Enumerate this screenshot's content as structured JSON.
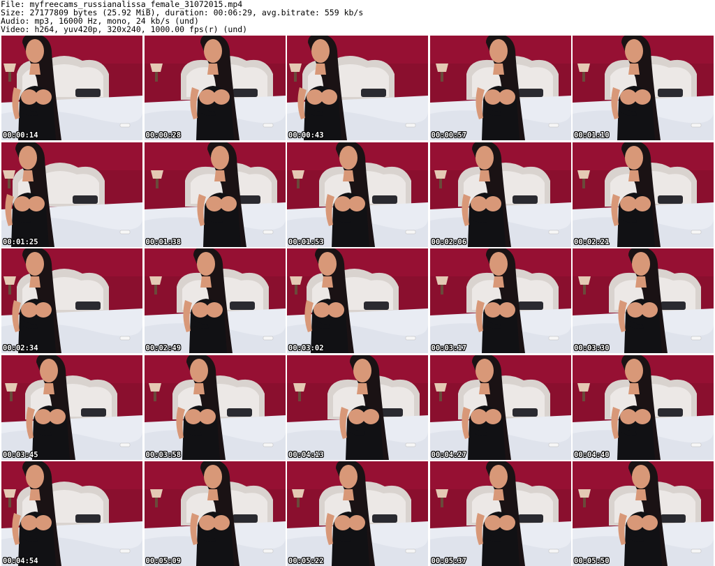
{
  "header": {
    "file_line": "File: myfreecams_russianalissa_female_31072015.mp4",
    "size_line": "Size: 27177809 bytes (25.92 MiB), duration: 00:06:29, avg.bitrate: 559 kb/s",
    "audio_line": "Audio: mp3, 16000 Hz, mono, 24 kb/s (und)",
    "video_line": "Video: h264, yuv420p, 320x240, 1000.00 fps(r) (und)"
  },
  "thumbnails": [
    {
      "timestamp": "00:00:14"
    },
    {
      "timestamp": "00:00:28"
    },
    {
      "timestamp": "00:00:43"
    },
    {
      "timestamp": "00:00:57"
    },
    {
      "timestamp": "00:01:10"
    },
    {
      "timestamp": "00:01:25"
    },
    {
      "timestamp": "00:01:38"
    },
    {
      "timestamp": "00:01:53"
    },
    {
      "timestamp": "00:02:06"
    },
    {
      "timestamp": "00:02:21"
    },
    {
      "timestamp": "00:02:34"
    },
    {
      "timestamp": "00:02:49"
    },
    {
      "timestamp": "00:03:02"
    },
    {
      "timestamp": "00:03:17"
    },
    {
      "timestamp": "00:03:30"
    },
    {
      "timestamp": "00:03:45"
    },
    {
      "timestamp": "00:03:58"
    },
    {
      "timestamp": "00:04:13"
    },
    {
      "timestamp": "00:04:27"
    },
    {
      "timestamp": "00:04:40"
    },
    {
      "timestamp": "00:04:54"
    },
    {
      "timestamp": "00:05:09"
    },
    {
      "timestamp": "00:05:22"
    },
    {
      "timestamp": "00:05:37"
    },
    {
      "timestamp": "00:05:50"
    }
  ],
  "colors": {
    "wall": "#8a0f2e",
    "headboard": "#d9d3cf",
    "bedsheet": "#e9ecf3",
    "lamp_shade": "#e4c9b4",
    "dress": "#111114",
    "hair": "#1a1214",
    "skin": "#d89878",
    "timestamp_text": "#ffffff"
  }
}
